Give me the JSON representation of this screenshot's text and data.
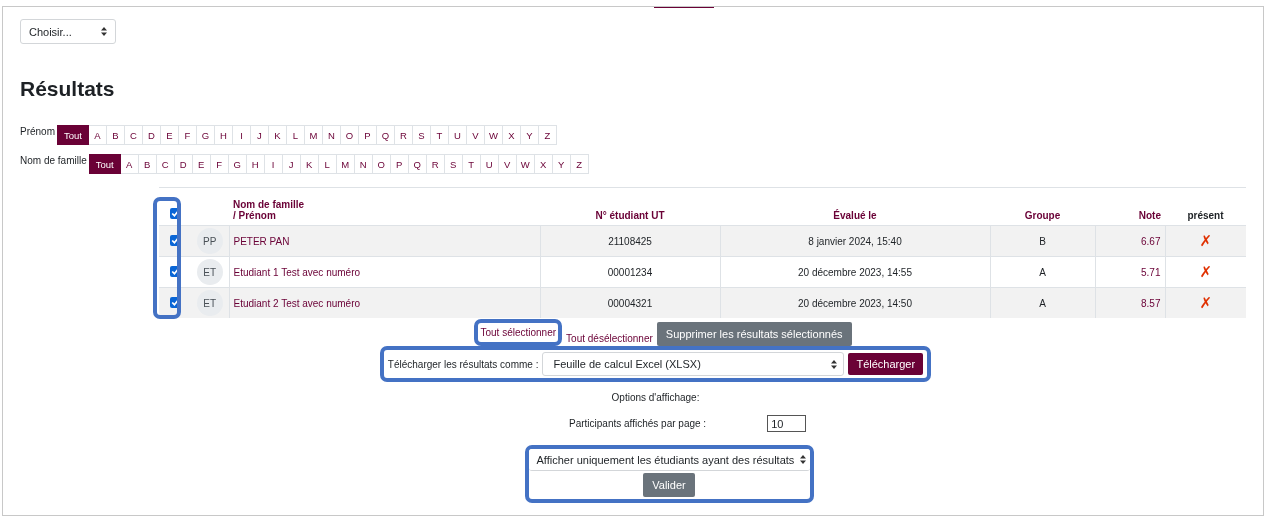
{
  "group_select": {
    "value": "Choisir..."
  },
  "heading": "Résultats",
  "filters": [
    {
      "label": "Prénom",
      "letters": [
        {
          "label": "Tout",
          "selected": true
        },
        {
          "label": "A",
          "selected": false
        },
        {
          "label": "B",
          "selected": false
        },
        {
          "label": "C",
          "selected": false
        },
        {
          "label": "D",
          "selected": false
        },
        {
          "label": "E",
          "selected": false
        },
        {
          "label": "F",
          "selected": false
        },
        {
          "label": "G",
          "selected": false
        },
        {
          "label": "H",
          "selected": false
        },
        {
          "label": "I",
          "selected": false
        },
        {
          "label": "J",
          "selected": false
        },
        {
          "label": "K",
          "selected": false
        },
        {
          "label": "L",
          "selected": false
        },
        {
          "label": "M",
          "selected": false
        },
        {
          "label": "N",
          "selected": false
        },
        {
          "label": "O",
          "selected": false
        },
        {
          "label": "P",
          "selected": false
        },
        {
          "label": "Q",
          "selected": false
        },
        {
          "label": "R",
          "selected": false
        },
        {
          "label": "S",
          "selected": false
        },
        {
          "label": "T",
          "selected": false
        },
        {
          "label": "U",
          "selected": false
        },
        {
          "label": "V",
          "selected": false
        },
        {
          "label": "W",
          "selected": false
        },
        {
          "label": "X",
          "selected": false
        },
        {
          "label": "Y",
          "selected": false
        },
        {
          "label": "Z",
          "selected": false
        }
      ]
    },
    {
      "label": "Nom de famille",
      "letters": [
        {
          "label": "Tout",
          "selected": true
        },
        {
          "label": "A",
          "selected": false
        },
        {
          "label": "B",
          "selected": false
        },
        {
          "label": "C",
          "selected": false
        },
        {
          "label": "D",
          "selected": false
        },
        {
          "label": "E",
          "selected": false
        },
        {
          "label": "F",
          "selected": false
        },
        {
          "label": "G",
          "selected": false
        },
        {
          "label": "H",
          "selected": false
        },
        {
          "label": "I",
          "selected": false
        },
        {
          "label": "J",
          "selected": false
        },
        {
          "label": "K",
          "selected": false
        },
        {
          "label": "L",
          "selected": false
        },
        {
          "label": "M",
          "selected": false
        },
        {
          "label": "N",
          "selected": false
        },
        {
          "label": "O",
          "selected": false
        },
        {
          "label": "P",
          "selected": false
        },
        {
          "label": "Q",
          "selected": false
        },
        {
          "label": "R",
          "selected": false
        },
        {
          "label": "S",
          "selected": false
        },
        {
          "label": "T",
          "selected": false
        },
        {
          "label": "U",
          "selected": false
        },
        {
          "label": "V",
          "selected": false
        },
        {
          "label": "W",
          "selected": false
        },
        {
          "label": "X",
          "selected": false
        },
        {
          "label": "Y",
          "selected": false
        },
        {
          "label": "Z",
          "selected": false
        }
      ]
    }
  ],
  "table": {
    "select_all_checked": true,
    "columns": {
      "name_line_1": "Nom de famille",
      "name_line_2": "/ Prénom",
      "number": "N° étudiant UT",
      "date": "Évalué le",
      "group": "Groupe",
      "note": "Note",
      "present": "présent"
    },
    "rows": [
      {
        "checked": true,
        "initials": "PP",
        "name": "PETER PAN",
        "number": "21108425",
        "date": "8 janvier 2024, 15:40",
        "group": "B",
        "note": "6.67",
        "present": false,
        "mark": "✗"
      },
      {
        "checked": true,
        "initials": "ET",
        "name": "Etudiant 1 Test avec numéro",
        "number": "00001234",
        "date": "20 décembre 2023, 14:55",
        "group": "A",
        "note": "5.71",
        "present": false,
        "mark": "✗"
      },
      {
        "checked": true,
        "initials": "ET",
        "name": "Etudiant 2 Test avec numéro",
        "number": "00004321",
        "date": "20 décembre 2023, 14:50",
        "group": "A",
        "note": "8.57",
        "present": false,
        "mark": "✗"
      }
    ]
  },
  "actions": {
    "select_all": "Tout sélectionner",
    "deselect_all": "Tout désélectionner",
    "delete": "Supprimer les résultats sélectionnés"
  },
  "download": {
    "label": "Télécharger les résultats comme :",
    "format": "Feuille de calcul Excel (XLSX)",
    "button": "Télécharger"
  },
  "options": {
    "title": "Options d'affichage:",
    "per_page_label": "Participants affichés par page :",
    "per_page_value": "10",
    "filter": "Afficher uniquement les étudiants ayant des résultats",
    "submit": "Valider"
  }
}
